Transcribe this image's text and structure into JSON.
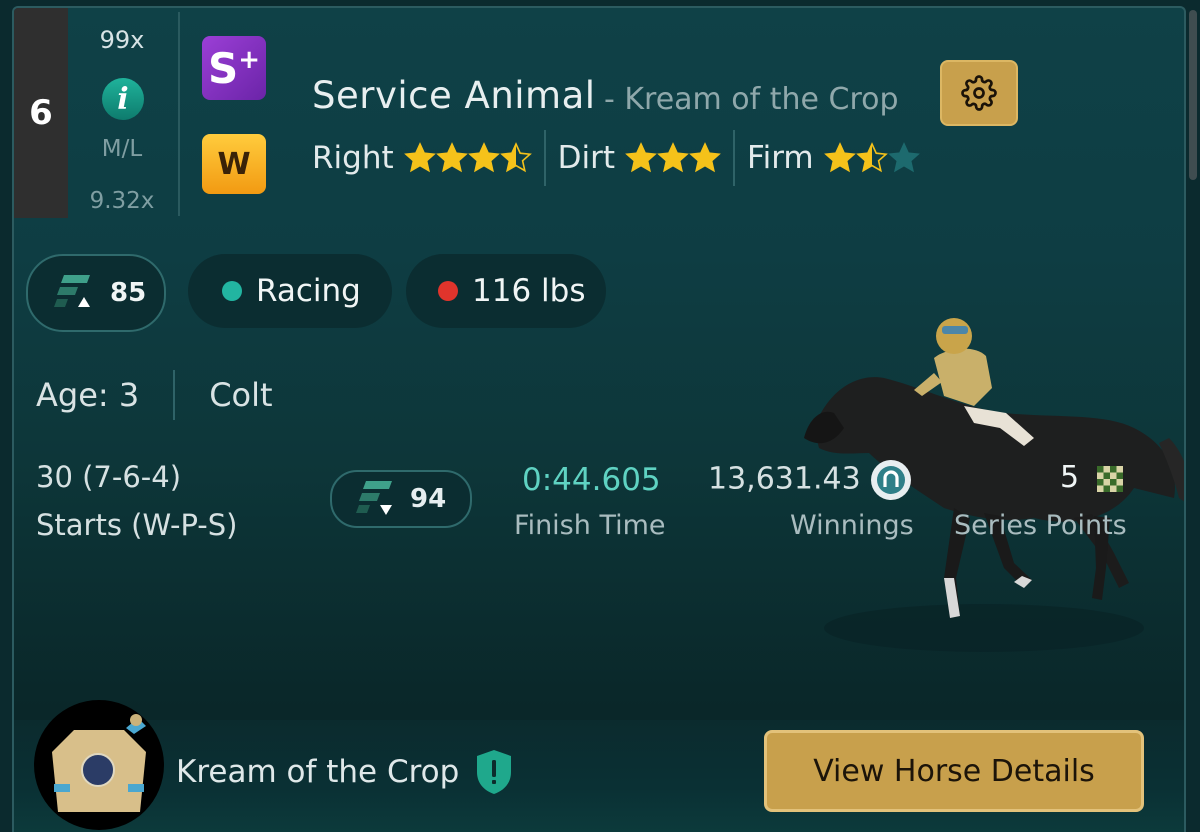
{
  "post_position": "6",
  "odds": {
    "current": "99x",
    "ml_label": "M/L",
    "morning_line": "9.32x"
  },
  "badges": {
    "class_letter": "S",
    "class_plus": "+",
    "weather": "W"
  },
  "horse": {
    "name": "Service Animal",
    "owner_suffix": "- Kream of the Crop"
  },
  "preferences": [
    {
      "label": "Right",
      "rating": 3.5,
      "max": 4
    },
    {
      "label": "Dirt",
      "rating": 3,
      "max": 3
    },
    {
      "label": "Firm",
      "rating": 1.5,
      "max": 3
    }
  ],
  "pills": {
    "rating": "85",
    "status": "Racing",
    "weight": "116 lbs"
  },
  "colors": {
    "accent_gold": "#c8a04c",
    "status_green": "#22b5a1",
    "weight_red": "#e0342c",
    "finish_time": "#5fd2c2",
    "star": "#f5c21a"
  },
  "details": {
    "age": "Age: 3",
    "sex": "Colt"
  },
  "stats": {
    "starts_value": "30 (7-6-4)",
    "starts_label": "Starts (W-P-S)",
    "speed_rating": "94",
    "finish_time": "0:44.605",
    "finish_label": "Finish Time",
    "winnings": "13,631.43",
    "winnings_label": "Winnings",
    "series_points": "5",
    "series_label": "Series Points"
  },
  "footer": {
    "owner": "Kream of the Crop",
    "button": "View Horse Details"
  },
  "icons": [
    "info-icon",
    "gear-icon",
    "star-icon",
    "rating-up-icon",
    "rating-down-icon",
    "horseshoe-coin-icon",
    "checkered-flag-icon",
    "shield-alert-icon"
  ]
}
